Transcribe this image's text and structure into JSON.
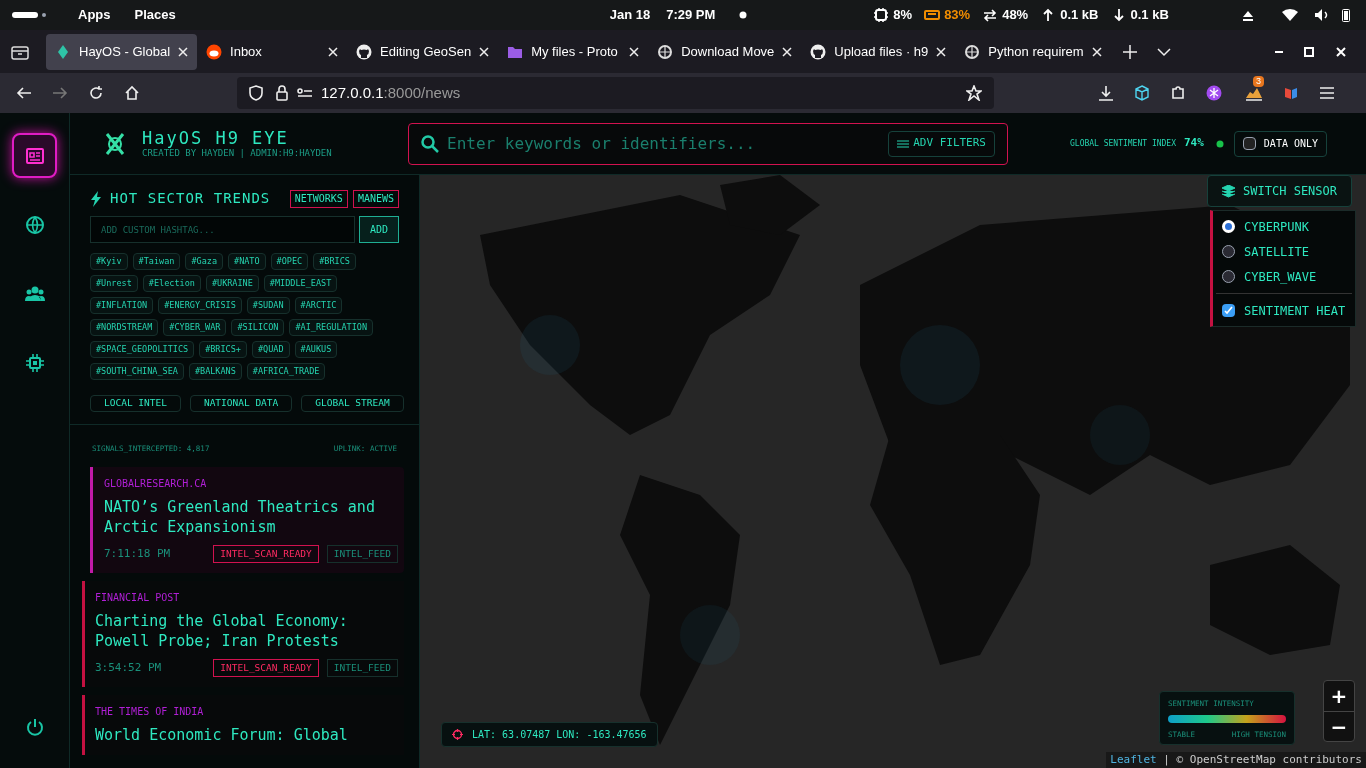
{
  "system_bar": {
    "menus": [
      "Apps",
      "Places"
    ],
    "date": "Jan 18",
    "time": "7:29 PM",
    "indicators": [
      {
        "kind": "cpu",
        "text": "8%"
      },
      {
        "kind": "battery",
        "text": "83%"
      },
      {
        "kind": "swap",
        "text": "48%"
      },
      {
        "kind": "up",
        "text": "0.1 kB"
      },
      {
        "kind": "down",
        "text": "0.1 kB"
      }
    ]
  },
  "browser": {
    "tabs": [
      {
        "title": "HayOS - Global",
        "kind": "diamond",
        "selected": true
      },
      {
        "title": "Inbox",
        "kind": "reddit",
        "selected": false
      },
      {
        "title": "Editing GeoSen",
        "kind": "github",
        "selected": false
      },
      {
        "title": "My files - Proto",
        "kind": "folder",
        "selected": false
      },
      {
        "title": "Download Move",
        "kind": "knot",
        "selected": false
      },
      {
        "title": "Upload files · h9",
        "kind": "github",
        "selected": false
      },
      {
        "title": "Python requirem",
        "kind": "knot",
        "selected": false
      }
    ],
    "url": {
      "host": "127.0.0.1",
      "rest": ":8000/news"
    },
    "extension_badge": "3"
  },
  "rail": [
    {
      "kind": "news",
      "selected": true
    },
    {
      "kind": "globe",
      "selected": false
    },
    {
      "kind": "users",
      "selected": false
    },
    {
      "kind": "chip",
      "selected": false
    }
  ],
  "header": {
    "title": "HayOS H9 EYE",
    "subtitle": "CREATED BY HAYDEN | ADMIN:H9:HAYDEN",
    "search_placeholder": "Enter keywords or identifiers...",
    "filters_button": "ADV FILTERS",
    "sentiment_label": "GLOBAL SENTIMENT INDEX",
    "sentiment_value": "74%",
    "data_only": {
      "label": "DATA ONLY",
      "checked": false
    }
  },
  "trends": {
    "title": "HOT SECTOR TRENDS",
    "sources": [
      "NETWORKS",
      "MANEWS"
    ],
    "hashtag_placeholder": "ADD CUSTOM HASHTAG...",
    "add_button": "ADD",
    "hashtags": [
      "#Kyiv",
      "#Taiwan",
      "#Gaza",
      "#NATO",
      "#OPEC",
      "#BRICS",
      "#Unrest",
      "#Election",
      "#UKRAINE",
      "#MIDDLE_EAST",
      "#INFLATION",
      "#ENERGY_CRISIS",
      "#SUDAN",
      "#ARCTIC",
      "#NORDSTREAM",
      "#CYBER_WAR",
      "#SILICON",
      "#AI_REGULATION",
      "#SPACE_GEOPOLITICS",
      "#BRICS+",
      "#QUAD",
      "#AUKUS",
      "#SOUTH_CHINA_SEA",
      "#BALKANS",
      "#AFRICA_TRADE"
    ],
    "scopes": [
      "LOCAL INTEL",
      "NATIONAL DATA",
      "GLOBAL STREAM"
    ],
    "signals": "SIGNALS_INTERCEPTED: 4,817",
    "uplink": "UPLINK: ACTIVE"
  },
  "news": [
    {
      "source": "GLOBALRESEARCH.CA",
      "title": "NATO’s Greenland Theatrics and Arctic Expansionism",
      "time": "7:11:18 PM",
      "tags": [
        "INTEL_SCAN_READY",
        "INTEL_FEED"
      ],
      "selected": true
    },
    {
      "source": "FINANCIAL POST",
      "title": "Charting the Global Economy: Powell Probe; Iran Protests",
      "time": "3:54:52 PM",
      "tags": [
        "INTEL_SCAN_READY",
        "INTEL_FEED"
      ],
      "selected": false
    },
    {
      "source": "THE TIMES OF INDIA",
      "title": "World Economic Forum: Global",
      "selected": false
    }
  ],
  "map": {
    "kind": "picture",
    "sensor_button": "SWITCH SENSOR",
    "layers": [
      {
        "kind": "radio",
        "label": "CYBERPUNK",
        "selected": true
      },
      {
        "kind": "radio",
        "label": "SATELLITE",
        "selected": false
      },
      {
        "kind": "radio",
        "label": "CYBER_WAVE",
        "selected": false
      },
      {
        "kind": "checkbox",
        "label": "SENTIMENT HEAT",
        "checked": true
      }
    ],
    "coords": "LAT: 63.07487 LON: -163.47656",
    "legend": {
      "title": "SENTIMENT INTENSITY",
      "low": "STABLE",
      "high": "HIGH TENSION"
    },
    "zoom": [
      "+",
      "−"
    ],
    "attribution_link": "Leaflet",
    "attribution": "| © OpenStreetMap contributors"
  }
}
